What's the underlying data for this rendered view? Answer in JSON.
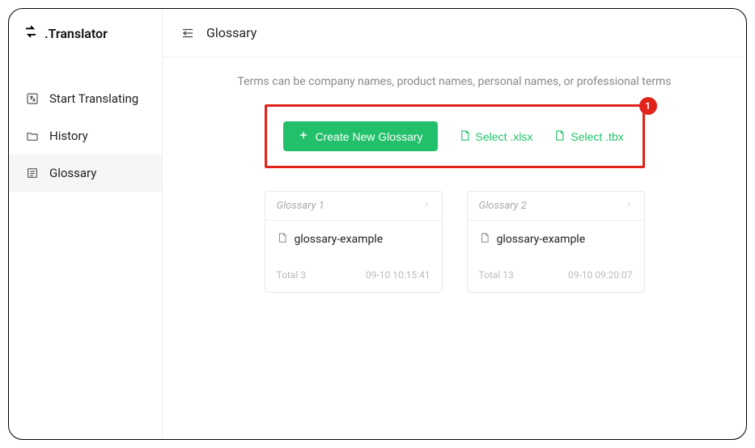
{
  "brand": {
    "name": ".Translator"
  },
  "sidebar": {
    "items": [
      {
        "label": "Start Translating"
      },
      {
        "label": "History"
      },
      {
        "label": "Glossary"
      }
    ]
  },
  "topbar": {
    "title": "Glossary"
  },
  "hint": "Terms can be company names, product names, personal names, or professional terms",
  "actions": {
    "create_label": "Create New Glossary",
    "select_xlsx_label": "Select .xlsx",
    "select_tbx_label": "Select .tbx"
  },
  "callout_badge": "1",
  "glossaries": [
    {
      "title": "Glossary 1",
      "filename": "glossary-example",
      "total_label": "Total 3",
      "timestamp": "09-10 10:15:41"
    },
    {
      "title": "Glossary 2",
      "filename": "glossary-example",
      "total_label": "Total 13",
      "timestamp": "09-10 09:20:07"
    }
  ]
}
